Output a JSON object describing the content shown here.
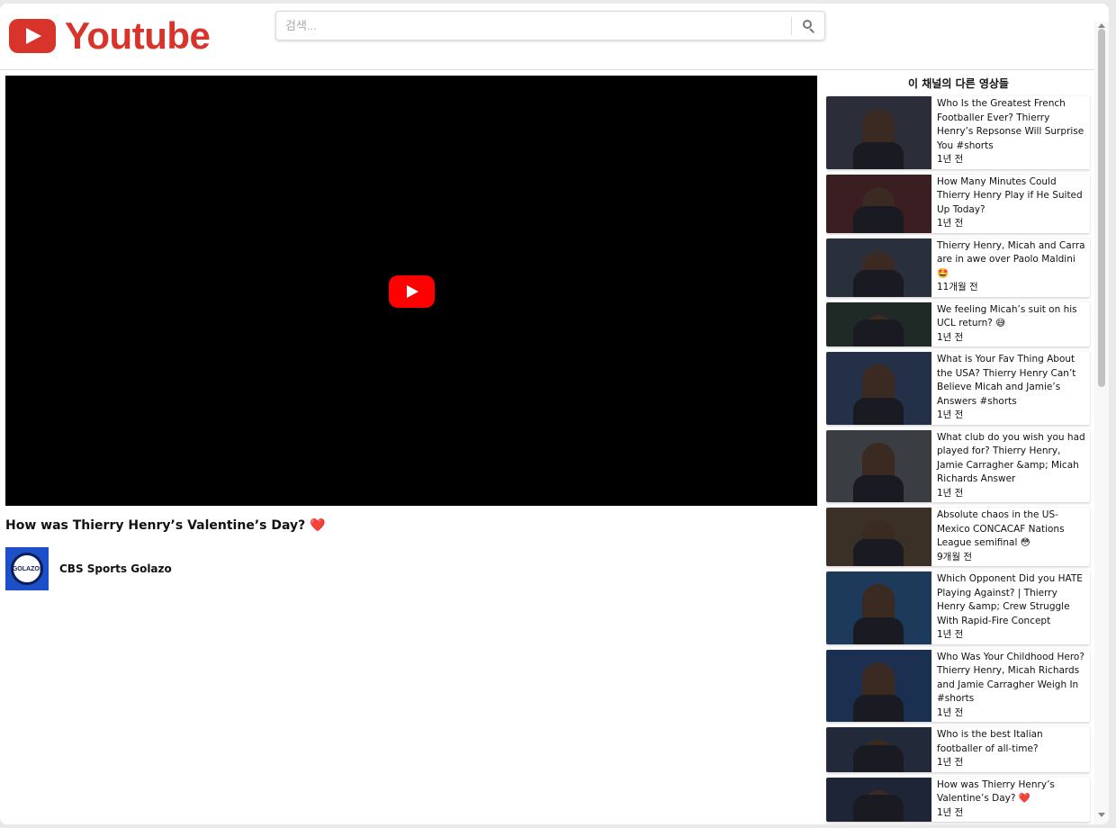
{
  "header": {
    "logo_text": "Youtube",
    "search_placeholder": "검색..."
  },
  "video": {
    "title": "How was Thierry Henry’s Valentine’s Day? ❤️",
    "channel_name": "CBS Sports Golazo",
    "channel_avatar_text": "GOLAZO!"
  },
  "sidebar": {
    "heading": "이 채널의 다른 영상들",
    "items": [
      {
        "title": "Who Is the Greatest French Footballer Ever? Thierry Henry’s Repsonse Will Surprise You #shorts",
        "age": "1년 전",
        "bg": "#2b2d38"
      },
      {
        "title": "How Many Minutes Could Thierry Henry Play if He Suited Up Today?",
        "age": "1년 전",
        "bg": "#3b1e22"
      },
      {
        "title": "Thierry Henry, Micah and Carra are in awe over Paolo Maldini 🤩",
        "age": "11개월 전",
        "bg": "#2a2f3c"
      },
      {
        "title": "We feeling Micah’s suit on his UCL return? 😅",
        "age": "1년 전",
        "bg": "#1f2a26"
      },
      {
        "title": "What is Your Fav Thing About the USA? Thierry Henry Can’t Believe Micah and Jamie’s Answers #shorts",
        "age": "1년 전",
        "bg": "#233048"
      },
      {
        "title": "What club do you wish you had played for? Thierry Henry, Jamie Carragher &amp; Micah Richards Answer",
        "age": "1년 전",
        "bg": "#3a3d42"
      },
      {
        "title": "Absolute chaos in the US-Mexico CONCACAF Nations League semifinal 😳",
        "age": "9개월 전",
        "bg": "#3b3026"
      },
      {
        "title": "Which Opponent Did you HATE Playing Against? | Thierry Henry &amp; Crew Struggle With Rapid-Fire Concept",
        "age": "1년 전",
        "bg": "#1e3a5a"
      },
      {
        "title": "Who Was Your Childhood Hero? Thierry Henry, Micah Richards and Jamie Carragher Weigh In #shorts",
        "age": "1년 전",
        "bg": "#1b3050"
      },
      {
        "title": "Who is the best Italian footballer of all-time?",
        "age": "1년 전",
        "bg": "#222a3a"
      },
      {
        "title": "How was Thierry Henry’s Valentine’s Day? ❤️",
        "age": "1년 전",
        "bg": "#1d2536"
      }
    ]
  }
}
